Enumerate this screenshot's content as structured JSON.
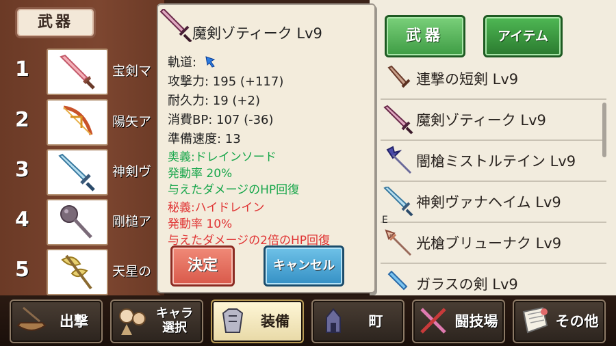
{
  "left_panel": {
    "header": "武器",
    "slots": [
      {
        "num": "1",
        "name": "宝剣マ",
        "icon": "sword-pink-icon"
      },
      {
        "num": "2",
        "name": "陽矢ア",
        "icon": "bow-icon"
      },
      {
        "num": "3",
        "name": "神剣ヴ",
        "icon": "sword-blue-icon"
      },
      {
        "num": "4",
        "name": "剛槌ア",
        "icon": "mace-icon"
      },
      {
        "num": "5",
        "name": "天星の",
        "icon": "axe-icon"
      }
    ]
  },
  "tabs": {
    "weapon": "武器",
    "item": "アイテム"
  },
  "detail": {
    "title": "魔剣ゾティーク Lv9",
    "trajectory_label": "軌道:",
    "attack": "攻撃力: 195 (+117)",
    "durability": "耐久力: 19 (+2)",
    "bp": "消費BP: 107 (-36)",
    "prep_speed": "準備速度: 13",
    "secret1_name": "奥義:ドレインソード",
    "secret1_rate": "発動率 20%",
    "secret1_desc": "与えたダメージのHP回復",
    "secret2_name": "秘義:ハイドレイン",
    "secret2_rate": "発動率 10%",
    "secret2_desc": "与えたダメージの2倍のHP回復",
    "confirm": "決定",
    "cancel": "キャンセル"
  },
  "item_list": [
    {
      "name": "連撃の短剣 Lv9",
      "icon": "dagger-icon"
    },
    {
      "name": "魔剣ゾティーク Lv9",
      "icon": "sword-dark-icon"
    },
    {
      "name": "闇槍ミストルテイン Lv9",
      "icon": "spear-dark-icon"
    },
    {
      "name": "神剣ヴァナヘイム Lv9",
      "icon": "sword-blue-icon",
      "equip_mark": "E"
    },
    {
      "name": "光槍ブリューナク Lv9",
      "icon": "spear-light-icon"
    },
    {
      "name": "ガラスの剣 Lv9",
      "icon": "sword-glass-icon"
    }
  ],
  "bottom_nav": [
    {
      "label": "出撃",
      "icon": "ship-icon"
    },
    {
      "label": "キャラ\n選択",
      "icon": "character-icon"
    },
    {
      "label": "装備",
      "icon": "armor-icon",
      "active": true
    },
    {
      "label": "町",
      "icon": "town-icon"
    },
    {
      "label": "闘技場",
      "icon": "arena-icon"
    },
    {
      "label": "その他",
      "icon": "scroll-icon"
    }
  ],
  "colors": {
    "skill_green": "#17a64a",
    "skill_red": "#e03434",
    "tab_green": "#3e9c44",
    "confirm_red": "#d9594a",
    "cancel_blue": "#3590c4"
  }
}
